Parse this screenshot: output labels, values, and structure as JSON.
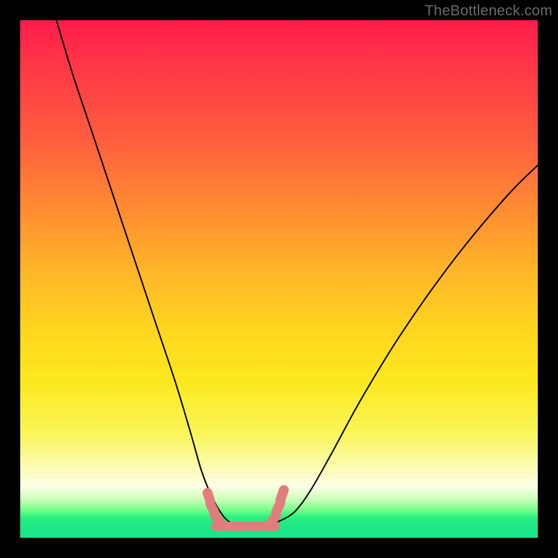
{
  "watermark": "TheBottleneck.com",
  "chart_data": {
    "type": "line",
    "title": "",
    "xlabel": "",
    "ylabel": "",
    "xlim": [
      0,
      100
    ],
    "ylim": [
      0,
      100
    ],
    "series": [
      {
        "name": "bottleneck-curve",
        "x": [
          7,
          10,
          14,
          18,
          22,
          26,
          30,
          33,
          35,
          37,
          39,
          40.5,
          42,
          45,
          48,
          50,
          53,
          56,
          60,
          66,
          74,
          84,
          94,
          100
        ],
        "y": [
          100,
          90,
          78,
          66,
          54,
          42,
          30,
          20,
          13,
          8,
          4.5,
          3,
          2.5,
          2.5,
          2.8,
          3.2,
          5,
          9,
          16,
          27,
          40,
          54,
          66,
          72
        ]
      }
    ],
    "annotations": [
      {
        "name": "optimal-range-marker",
        "type": "tick-mark",
        "color": "#e17d7d",
        "x_range": [
          37,
          50
        ],
        "y_level": 2.5
      }
    ],
    "background": {
      "type": "vertical-gradient",
      "stops": [
        {
          "pos": 0.0,
          "color": "#ff1b4a"
        },
        {
          "pos": 0.6,
          "color": "#ffd61f"
        },
        {
          "pos": 0.9,
          "color": "#fdffe8"
        },
        {
          "pos": 1.0,
          "color": "#19e68b"
        }
      ]
    }
  }
}
